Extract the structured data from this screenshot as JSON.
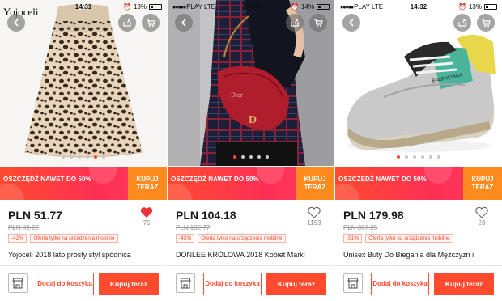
{
  "colors": {
    "accent": "#ff4a2e",
    "promo_orange": "#ff8a1e",
    "heart_filled": "#f0303a"
  },
  "screens": [
    {
      "status": {
        "carrier": "",
        "time": "14:31",
        "right": "13%"
      },
      "watermark": "Yojoceli",
      "promo": {
        "text": "OSZCZĘDŹ NAWET DO 50%",
        "button": "KUPUJ TERAZ"
      },
      "price": "PLN 51.77",
      "old_price": "PLN 89.22",
      "discount": "-42%",
      "mobile_only": "Oferta tylko na urządzenia mobilne",
      "favorites": "75",
      "favorited": true,
      "title": "Yojoceli 2018 lato prosty styl spódnica",
      "buttons": {
        "add_to_cart": "Dodaj do koszyka",
        "buy_now": "Kupuj teraz"
      },
      "image": {
        "subject": "leopard-print-skirt",
        "active_dot": 5
      }
    },
    {
      "status": {
        "carrier": "PLAY LTE",
        "time": "14:30",
        "right": "14%"
      },
      "watermark": "",
      "promo": {
        "text": "OSZCZĘDŹ NAWET DO 50%",
        "button": "KUPUJ TERAZ"
      },
      "price": "PLN 104.18",
      "old_price": "PLN 182.77",
      "discount": "-43%",
      "mobile_only": "Oferta tylko na urządzenia mobilne",
      "favorites": "1153",
      "favorited": false,
      "title": "DONLEE KRÓLOWA 2018 Kobiet Marki",
      "buttons": {
        "add_to_cart": "Dodaj do koszyka",
        "buy_now": "Kupuj teraz"
      },
      "image": {
        "subject": "red-saddle-handbag",
        "active_dot": 1
      }
    },
    {
      "status": {
        "carrier": "PLAY LTE",
        "time": "14:32",
        "right": "13%"
      },
      "watermark": "",
      "promo": {
        "text": "OSZCZĘDŹ NAWET DO 50%",
        "button": "KUPUJ TERAZ"
      },
      "price": "PLN 179.98",
      "old_price": "PLN 367.25",
      "discount": "-51%",
      "mobile_only": "Oferta tylko na urządzenia mobilne",
      "favorites": "23",
      "favorited": false,
      "title": "Unisex Buty Do Biegania dla Mężczyzn i",
      "buttons": {
        "add_to_cart": "Dodaj do koszyka",
        "buy_now": "Kupuj teraz"
      },
      "image": {
        "subject": "chunky-sneaker",
        "active_dot": 1,
        "shoe_text": "BALENCIAGA"
      }
    }
  ]
}
